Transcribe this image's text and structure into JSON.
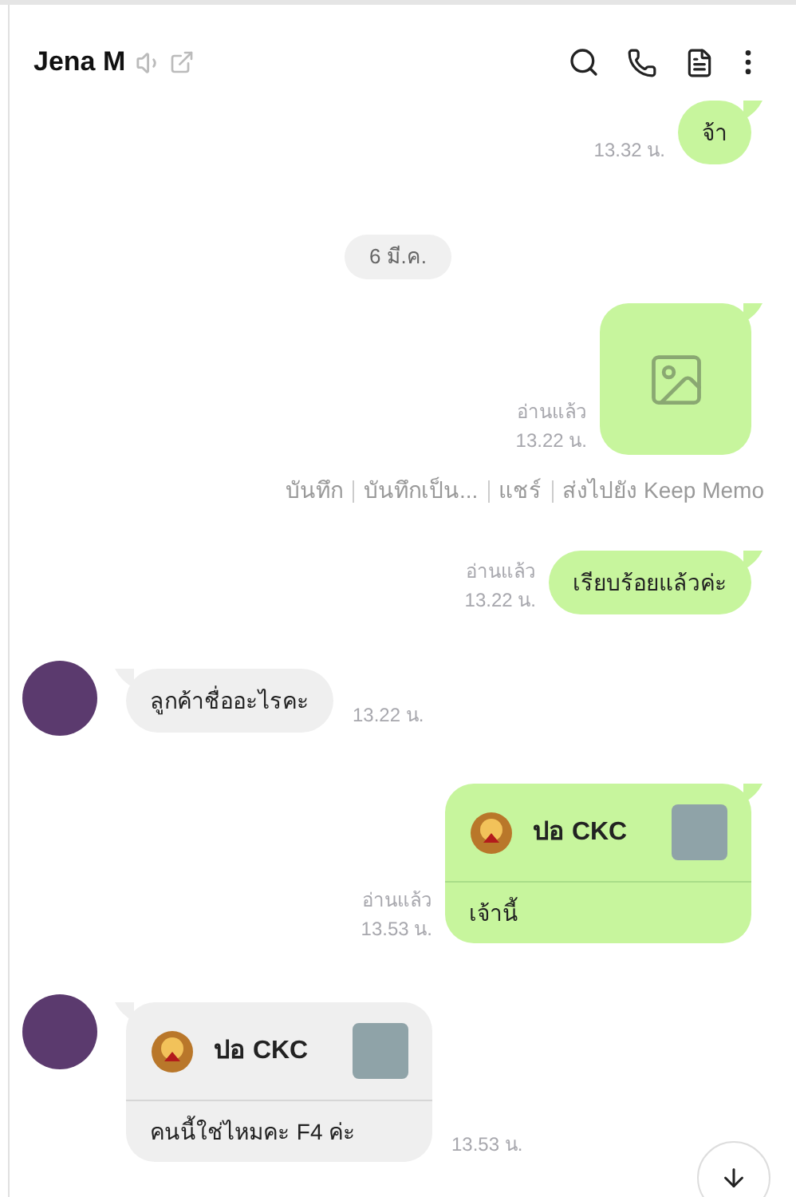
{
  "header": {
    "title": "Jena M"
  },
  "messages": [
    {
      "kind": "text",
      "outgoing": true,
      "text": "จ้า",
      "time": "13.32 น."
    },
    {
      "kind": "date",
      "text": "6 มี.ค."
    },
    {
      "kind": "image",
      "outgoing": true,
      "read": "อ่านแล้ว",
      "time": "13.22 น."
    },
    {
      "kind": "actions",
      "items": [
        "บันทึก",
        "บันทึกเป็น...",
        "แชร์",
        "ส่งไปยัง Keep Memo"
      ]
    },
    {
      "kind": "text",
      "outgoing": true,
      "read": "อ่านแล้ว",
      "text": "เรียบร้อยแล้วค่ะ",
      "time": "13.22 น."
    },
    {
      "kind": "text",
      "outgoing": false,
      "text": "ลูกค้าชื่ออะไรคะ",
      "time": "13.22 น."
    },
    {
      "kind": "contact",
      "outgoing": true,
      "name": "ปอ CKC",
      "text": "เจ้านี้",
      "read": "อ่านแล้ว",
      "time": "13.53 น."
    },
    {
      "kind": "contact",
      "outgoing": false,
      "name": "ปอ CKC",
      "text": "คนนี้ใช่ไหมคะ F4 ค่ะ",
      "time": "13.53 น."
    }
  ]
}
